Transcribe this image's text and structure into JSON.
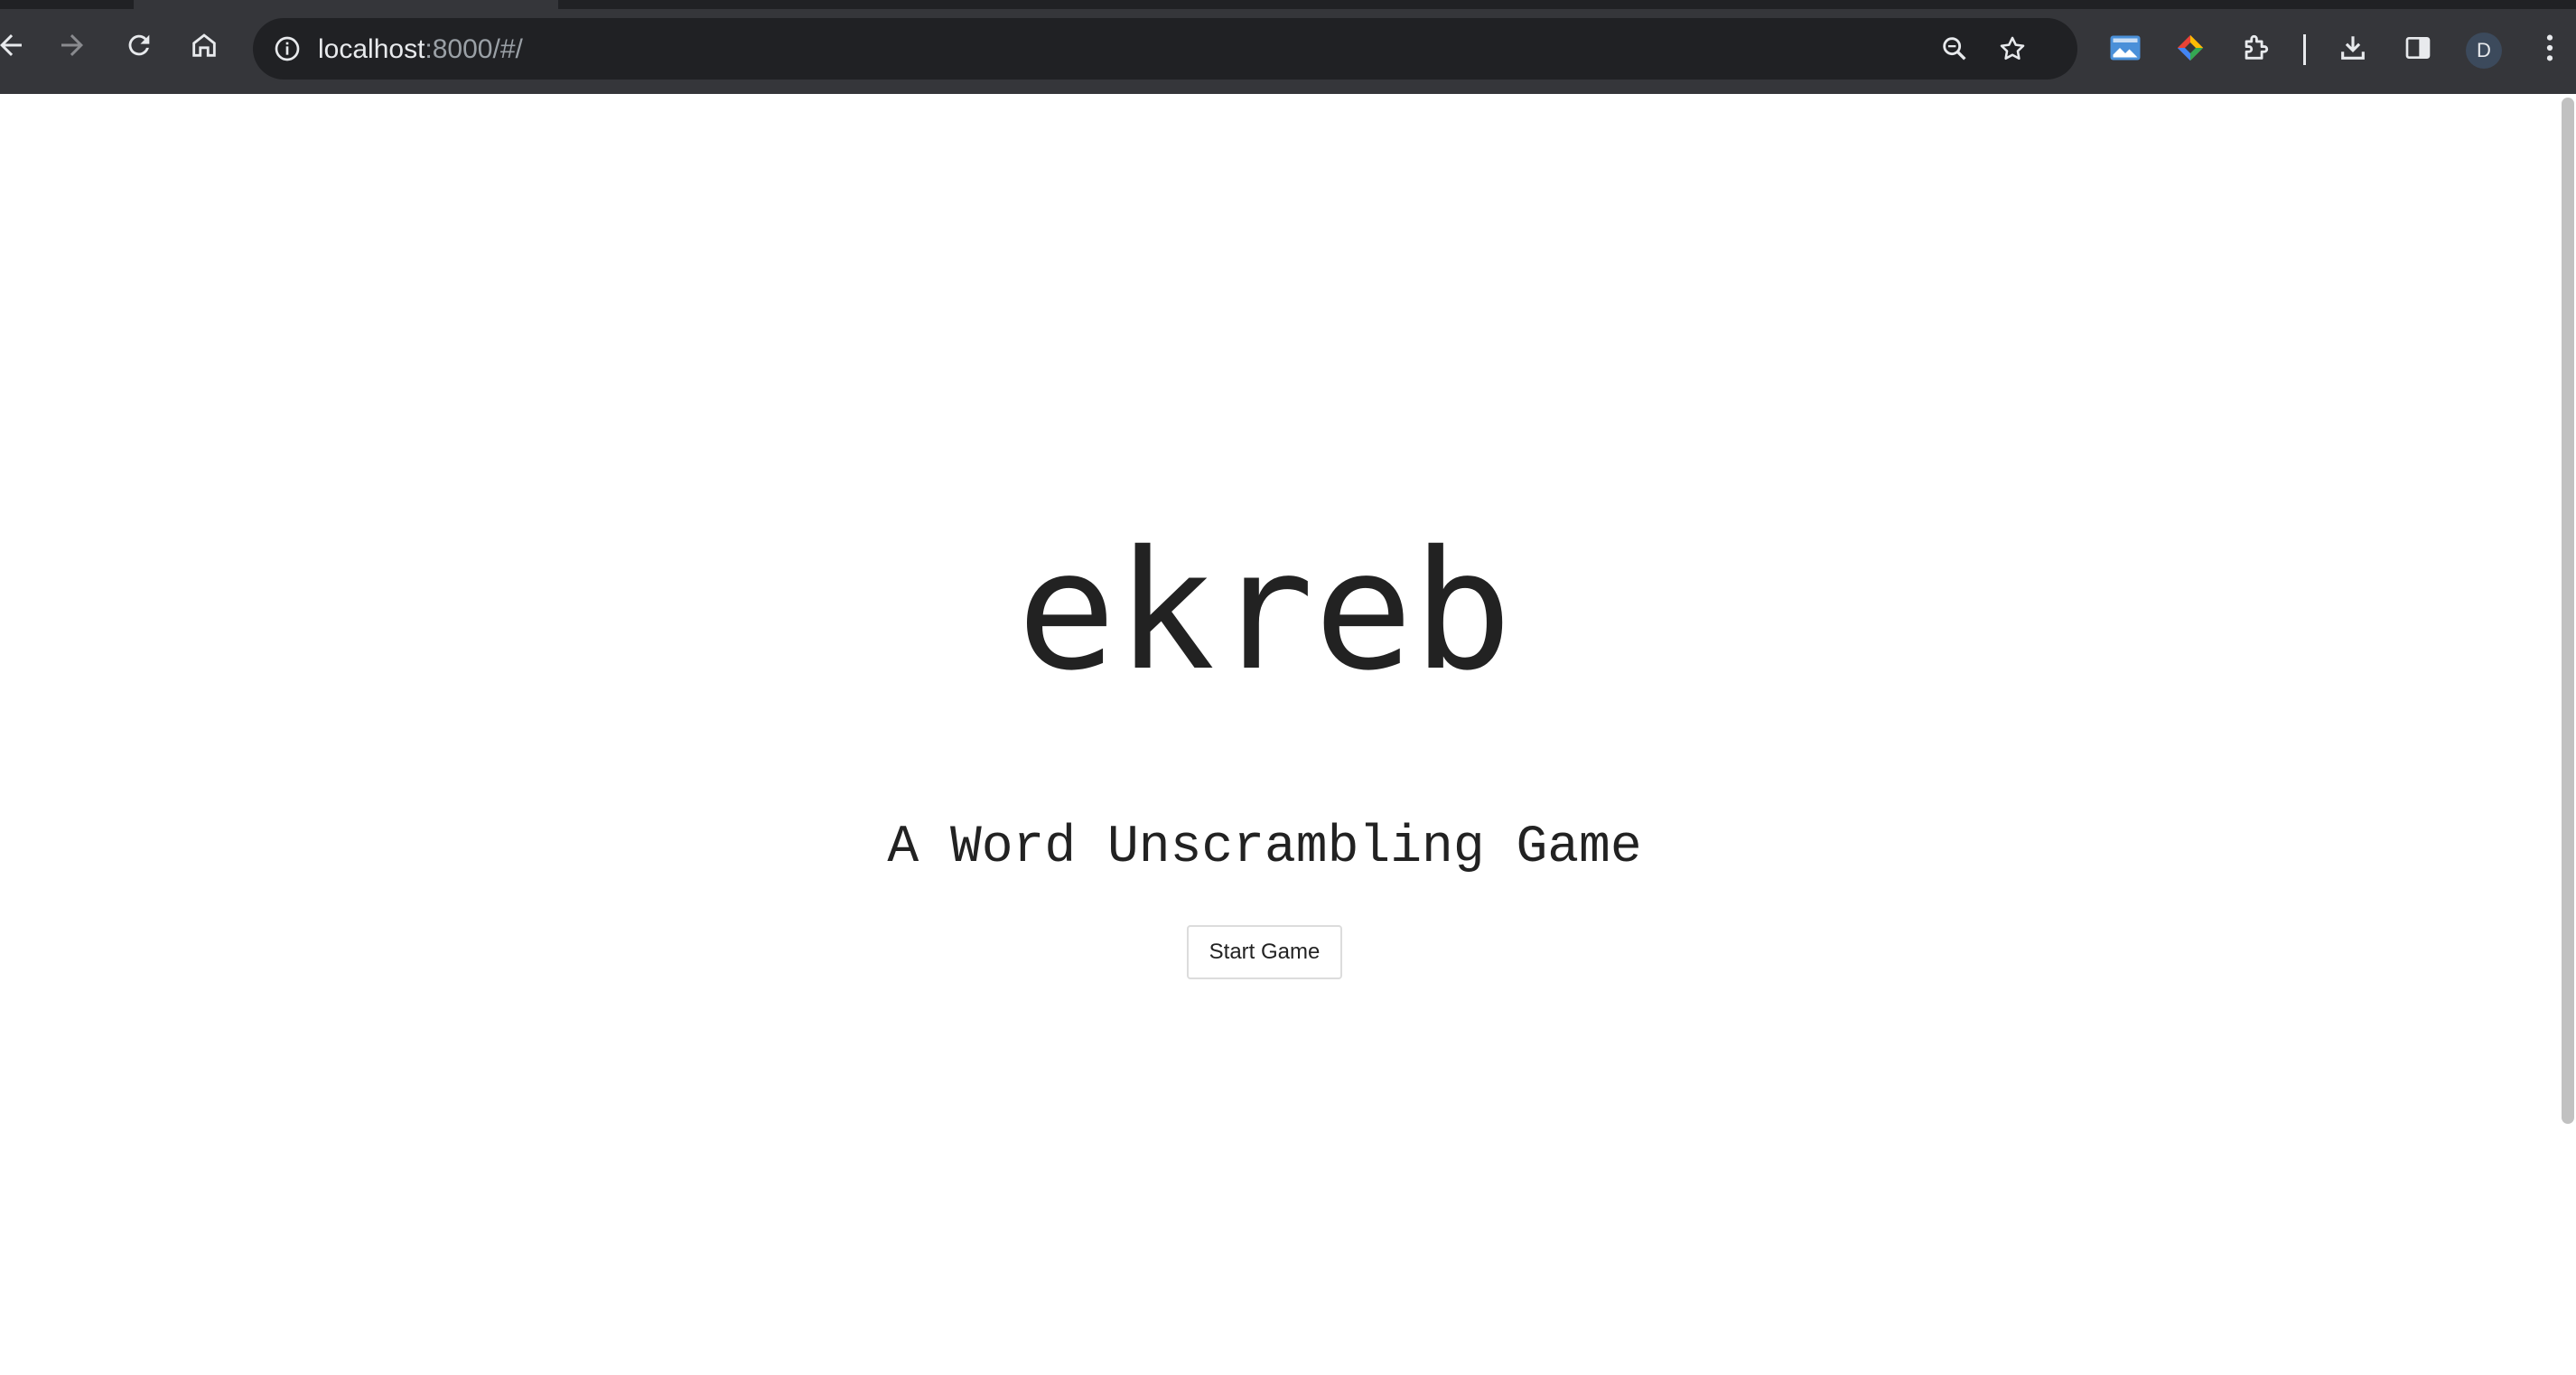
{
  "browser": {
    "url_host": "localhost",
    "url_path": ":8000/#/",
    "profile_initial": "D",
    "toolbar_icons": [
      "back-icon",
      "forward-icon",
      "reload-icon",
      "home-icon",
      "site-info-icon",
      "zoom-icon",
      "bookmark-star-icon",
      "extension-screenshot-icon",
      "extension-color-icon",
      "extensions-puzzle-icon",
      "downloads-icon",
      "side-panel-icon",
      "menu-dots-icon"
    ],
    "colors": {
      "frame": "#35363a",
      "omnibox": "#202124",
      "text": "#e8eaed",
      "muted": "#9aa0a6"
    }
  },
  "page": {
    "title": "ekreb",
    "subtitle": "A Word Unscrambling Game",
    "start_button": "Start Game",
    "colors": {
      "background": "#ffffff",
      "text": "#222222"
    }
  }
}
